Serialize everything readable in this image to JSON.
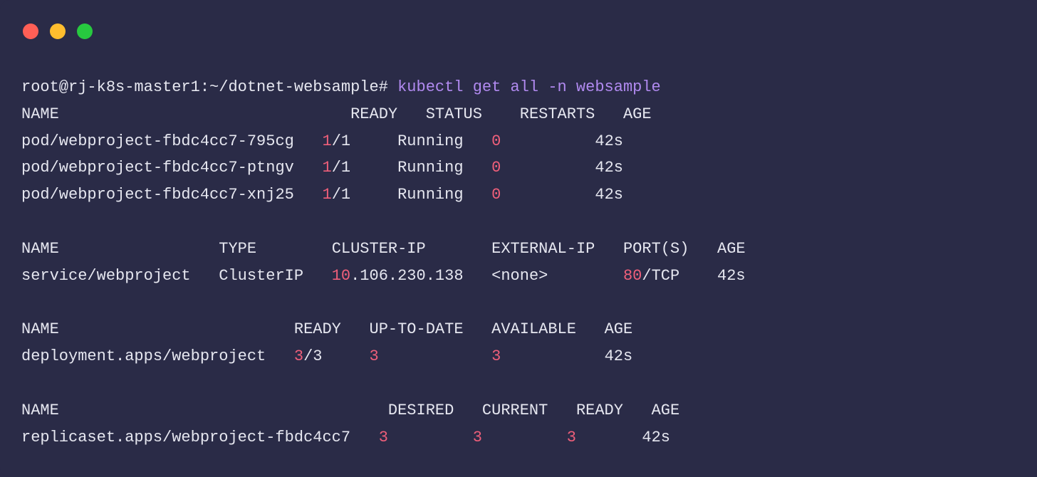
{
  "colors": {
    "bg": "#2a2b47",
    "text": "#e6e7f0",
    "command": "#b18af0",
    "number": "#ef5f7a",
    "tl_red": "#ff5f56",
    "tl_yellow": "#ffbd2e",
    "tl_green": "#27c93f"
  },
  "prompt": "root@rj-k8s-master1:~/dotnet-websample# ",
  "command": "kubectl get all -n websample",
  "pods": {
    "headers": [
      "NAME",
      "READY",
      "STATUS",
      "RESTARTS",
      "AGE"
    ],
    "rows": [
      {
        "name": "pod/webproject-fbdc4cc7-795cg",
        "ready_num": "1",
        "ready_den": "/1",
        "status": "Running",
        "restarts": "0",
        "age": "42s"
      },
      {
        "name": "pod/webproject-fbdc4cc7-ptngv",
        "ready_num": "1",
        "ready_den": "/1",
        "status": "Running",
        "restarts": "0",
        "age": "42s"
      },
      {
        "name": "pod/webproject-fbdc4cc7-xnj25",
        "ready_num": "1",
        "ready_den": "/1",
        "status": "Running",
        "restarts": "0",
        "age": "42s"
      }
    ]
  },
  "services": {
    "headers": [
      "NAME",
      "TYPE",
      "CLUSTER-IP",
      "EXTERNAL-IP",
      "PORT(S)",
      "AGE"
    ],
    "rows": [
      {
        "name": "service/webproject",
        "type": "ClusterIP",
        "cip_num": "10",
        "cip_rest": ".106.230.138",
        "ext_ip": "<none>",
        "port_num": "80",
        "port_rest": "/TCP",
        "age": "42s"
      }
    ]
  },
  "deployments": {
    "headers": [
      "NAME",
      "READY",
      "UP-TO-DATE",
      "AVAILABLE",
      "AGE"
    ],
    "rows": [
      {
        "name": "deployment.apps/webproject",
        "ready_num": "3",
        "ready_den": "/3",
        "uptodate": "3",
        "available": "3",
        "age": "42s"
      }
    ]
  },
  "replicasets": {
    "headers": [
      "NAME",
      "DESIRED",
      "CURRENT",
      "READY",
      "AGE"
    ],
    "rows": [
      {
        "name": "replicaset.apps/webproject-fbdc4cc7",
        "desired": "3",
        "current": "3",
        "ready": "3",
        "age": "42s"
      }
    ]
  }
}
